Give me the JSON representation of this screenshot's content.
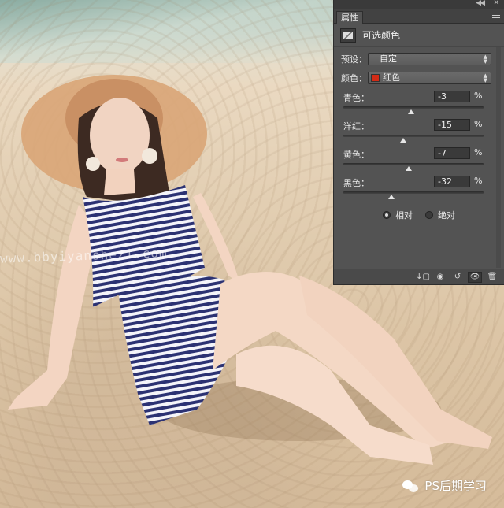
{
  "photo": {
    "watermark": "www.bbyiyanshezi.com",
    "corner_logo": "PS后期学习"
  },
  "panel": {
    "tab_label": "属性",
    "adjustment_title": "可选颜色",
    "preset": {
      "label": "预设：",
      "value": "自定"
    },
    "colors": {
      "label": "颜色：",
      "value": "红色",
      "swatch_color": "#d22b16"
    },
    "sliders": [
      {
        "label": "青色：",
        "value": "-3",
        "unit": "%",
        "level_percent": -3
      },
      {
        "label": "洋红：",
        "value": "-15",
        "unit": "%",
        "level_percent": -15
      },
      {
        "label": "黄色：",
        "value": "-7",
        "unit": "%",
        "level_percent": -7
      },
      {
        "label": "黑色：",
        "value": "-32",
        "unit": "%",
        "level_percent": -32
      }
    ],
    "method": {
      "options": [
        {
          "label": "相对",
          "selected": true
        },
        {
          "label": "绝对",
          "selected": false
        }
      ]
    },
    "bottom_icons": [
      "clip-to-layer-icon",
      "view-previous-icon",
      "reset-icon",
      "visibility-eye-icon",
      "trash-icon"
    ]
  }
}
